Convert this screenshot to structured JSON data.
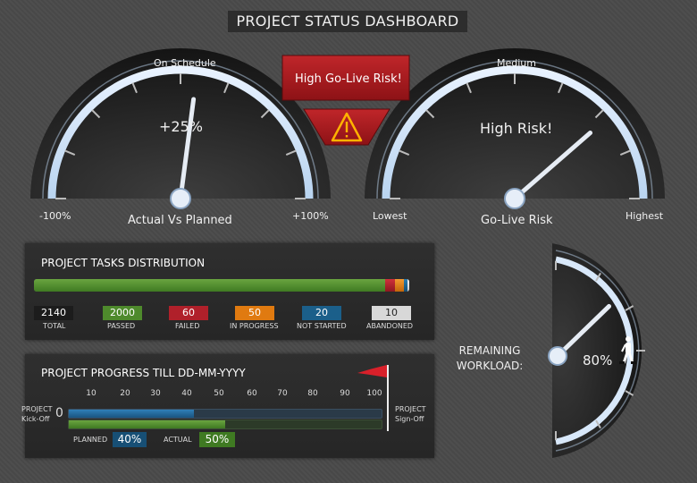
{
  "header": {
    "title": "PROJECT STATUS DASHBOARD"
  },
  "gauge_actual": {
    "label_top": "On Schedule",
    "value_text": "+25%",
    "value": 25,
    "min_label": "-100%",
    "max_label": "+100%",
    "caption": "Actual Vs Planned"
  },
  "warning": {
    "text": "High Go-Live Risk!"
  },
  "gauge_risk": {
    "label_top": "Medium",
    "value_text": "High Risk!",
    "min_label": "Lowest",
    "max_label": "Highest",
    "caption": "Go-Live Risk",
    "level": 0.8
  },
  "tasks": {
    "title": "PROJECT TASKS DISTRIBUTION",
    "total": {
      "value": "2140",
      "label": "TOTAL"
    },
    "items": [
      {
        "value": "2000",
        "label": "PASSED",
        "color": "#4e8a2c"
      },
      {
        "value": "60",
        "label": "FAILED",
        "color": "#b0202a"
      },
      {
        "value": "50",
        "label": "IN PROGRESS",
        "color": "#e07a10"
      },
      {
        "value": "20",
        "label": "NOT STARTED",
        "color": "#1b5f8a"
      },
      {
        "value": "10",
        "label": "ABANDONED",
        "color": "#d8d8d8"
      }
    ]
  },
  "progress": {
    "title": "PROJECT PROGRESS TILL DD-MM-YYYY",
    "ticks": [
      "10",
      "20",
      "30",
      "40",
      "50",
      "60",
      "70",
      "80",
      "90",
      "100"
    ],
    "zero": "0",
    "start_label": "PROJECT Kick-Off",
    "end_label": "PROJECT Sign-Off",
    "planned": {
      "label": "PLANNED",
      "value_text": "40%",
      "value": 0.4
    },
    "actual": {
      "label": "ACTUAL",
      "value_text": "50%",
      "value": 0.5
    }
  },
  "workload": {
    "label": "REMAINING WORKLOAD:",
    "value_text": "80%",
    "value": 0.8
  }
}
